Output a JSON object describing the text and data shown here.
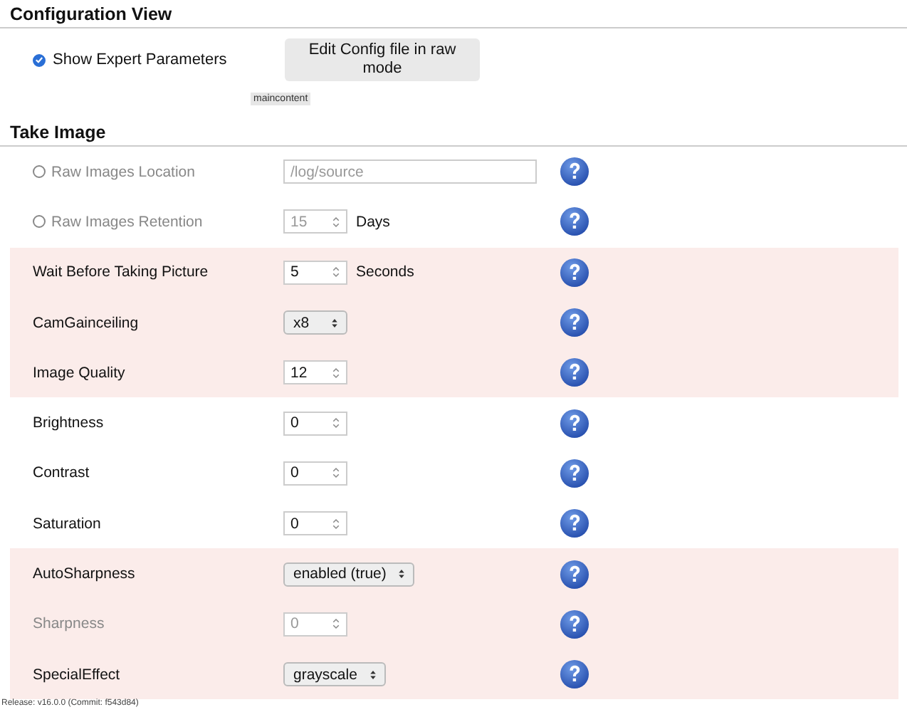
{
  "configuration_view": {
    "title": "Configuration View",
    "expert_parameters": {
      "label": "Show Expert Parameters",
      "checked": true
    },
    "edit_button": "Edit Config file in raw mode",
    "tag": "maincontent"
  },
  "take_image": {
    "title": "Take Image",
    "rows": [
      {
        "label": "Raw Images Location",
        "kind": "checkbox",
        "checked": false,
        "disabled": true,
        "highlighted": false,
        "control": {
          "kind": "text",
          "value": "/log/source"
        }
      },
      {
        "label": "Raw Images Retention",
        "kind": "checkbox",
        "checked": false,
        "disabled": true,
        "highlighted": false,
        "control": {
          "kind": "number",
          "value": "15",
          "unit": "Days"
        }
      },
      {
        "label": "Wait Before Taking Picture",
        "kind": "plain",
        "disabled": false,
        "highlighted": true,
        "control": {
          "kind": "number",
          "value": "5",
          "unit": "Seconds"
        }
      },
      {
        "label": "CamGainceiling",
        "kind": "plain",
        "disabled": false,
        "highlighted": true,
        "control": {
          "kind": "select",
          "value": "x8"
        }
      },
      {
        "label": "Image Quality",
        "kind": "plain",
        "disabled": false,
        "highlighted": true,
        "control": {
          "kind": "number",
          "value": "12"
        }
      },
      {
        "label": "Brightness",
        "kind": "plain",
        "disabled": false,
        "highlighted": false,
        "control": {
          "kind": "number",
          "value": "0"
        }
      },
      {
        "label": "Contrast",
        "kind": "plain",
        "disabled": false,
        "highlighted": false,
        "control": {
          "kind": "number",
          "value": "0"
        }
      },
      {
        "label": "Saturation",
        "kind": "plain",
        "disabled": false,
        "highlighted": false,
        "control": {
          "kind": "number",
          "value": "0"
        }
      },
      {
        "label": "AutoSharpness",
        "kind": "plain",
        "disabled": false,
        "highlighted": true,
        "control": {
          "kind": "select",
          "value": "enabled (true)"
        }
      },
      {
        "label": "Sharpness",
        "kind": "plain",
        "disabled": true,
        "highlighted": true,
        "control": {
          "kind": "number",
          "value": "0"
        }
      },
      {
        "label": "SpecialEffect",
        "kind": "plain",
        "disabled": false,
        "highlighted": true,
        "control": {
          "kind": "select",
          "value": "grayscale"
        }
      }
    ]
  },
  "footer": "Release: v16.0.0 (Commit: f543d84)"
}
